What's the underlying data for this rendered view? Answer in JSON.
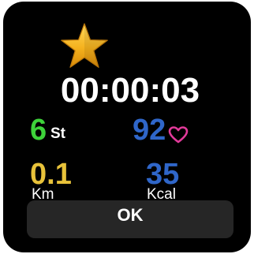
{
  "timer": {
    "elapsed": "00:00:03"
  },
  "stats": {
    "steps": {
      "value": "6",
      "unit": "St"
    },
    "heart_rate": {
      "value": "92",
      "icon": "heart-icon"
    },
    "distance": {
      "value": "0.1",
      "unit": "Km"
    },
    "calories": {
      "value": "35",
      "unit": "Kcal"
    }
  },
  "actions": {
    "ok_label": "OK"
  },
  "icons": {
    "top": "star-icon"
  },
  "colors": {
    "background": "#000000",
    "steps": "#3ed33a",
    "heart_rate": "#2f66c9",
    "heart": "#e23a9a",
    "distance": "#e8c23a",
    "calories": "#2f66c9",
    "star": "#f5b21e",
    "button": "#262626"
  }
}
